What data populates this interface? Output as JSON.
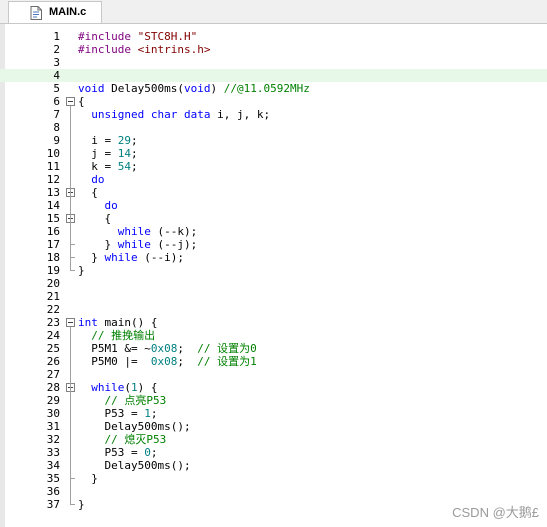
{
  "tab": {
    "label": "MAIN.c",
    "icon": "c-file-icon"
  },
  "lines": [
    {
      "n": "1",
      "tokens": [
        {
          "t": "#include ",
          "c": "pp"
        },
        {
          "t": "\"STC8H.H\"",
          "c": "str"
        }
      ]
    },
    {
      "n": "2",
      "tokens": [
        {
          "t": "#include ",
          "c": "pp"
        },
        {
          "t": "<intrins.h>",
          "c": "str"
        }
      ]
    },
    {
      "n": "3",
      "tokens": []
    },
    {
      "n": "4",
      "tokens": [],
      "highlight": true
    },
    {
      "n": "5",
      "tokens": [
        {
          "t": "void",
          "c": "kw"
        },
        {
          "t": " Delay500ms(",
          "c": "id"
        },
        {
          "t": "void",
          "c": "kw"
        },
        {
          "t": ")\t",
          "c": "id"
        },
        {
          "t": "//@11.0592MHz",
          "c": "cm"
        }
      ]
    },
    {
      "n": "6",
      "tokens": [
        {
          "t": "{",
          "c": "id"
        }
      ]
    },
    {
      "n": "7",
      "tokens": [
        {
          "t": "  ",
          "c": "id"
        },
        {
          "t": "unsigned char data",
          "c": "kw"
        },
        {
          "t": " i, j, k;",
          "c": "id"
        }
      ]
    },
    {
      "n": "8",
      "tokens": []
    },
    {
      "n": "9",
      "tokens": [
        {
          "t": "  i = ",
          "c": "id"
        },
        {
          "t": "29",
          "c": "num"
        },
        {
          "t": ";",
          "c": "id"
        }
      ]
    },
    {
      "n": "10",
      "tokens": [
        {
          "t": "  j = ",
          "c": "id"
        },
        {
          "t": "14",
          "c": "num"
        },
        {
          "t": ";",
          "c": "id"
        }
      ]
    },
    {
      "n": "11",
      "tokens": [
        {
          "t": "  k = ",
          "c": "id"
        },
        {
          "t": "54",
          "c": "num"
        },
        {
          "t": ";",
          "c": "id"
        }
      ]
    },
    {
      "n": "12",
      "tokens": [
        {
          "t": "  ",
          "c": "id"
        },
        {
          "t": "do",
          "c": "kw"
        }
      ]
    },
    {
      "n": "13",
      "tokens": [
        {
          "t": "  {",
          "c": "id"
        }
      ]
    },
    {
      "n": "14",
      "tokens": [
        {
          "t": "    ",
          "c": "id"
        },
        {
          "t": "do",
          "c": "kw"
        }
      ]
    },
    {
      "n": "15",
      "tokens": [
        {
          "t": "    {",
          "c": "id"
        }
      ]
    },
    {
      "n": "16",
      "tokens": [
        {
          "t": "      ",
          "c": "id"
        },
        {
          "t": "while",
          "c": "kw"
        },
        {
          "t": " (--k);",
          "c": "id"
        }
      ]
    },
    {
      "n": "17",
      "tokens": [
        {
          "t": "    } ",
          "c": "id"
        },
        {
          "t": "while",
          "c": "kw"
        },
        {
          "t": " (--j);",
          "c": "id"
        }
      ]
    },
    {
      "n": "18",
      "tokens": [
        {
          "t": "  } ",
          "c": "id"
        },
        {
          "t": "while",
          "c": "kw"
        },
        {
          "t": " (--i);",
          "c": "id"
        }
      ]
    },
    {
      "n": "19",
      "tokens": [
        {
          "t": "}",
          "c": "id"
        }
      ]
    },
    {
      "n": "20",
      "tokens": []
    },
    {
      "n": "21",
      "tokens": []
    },
    {
      "n": "22",
      "tokens": []
    },
    {
      "n": "23",
      "tokens": [
        {
          "t": "int",
          "c": "kw"
        },
        {
          "t": " main() {",
          "c": "id"
        }
      ]
    },
    {
      "n": "24",
      "tokens": [
        {
          "t": "  ",
          "c": "id"
        },
        {
          "t": "// 推挽输出",
          "c": "cm"
        }
      ]
    },
    {
      "n": "25",
      "tokens": [
        {
          "t": "  P5M1 &= ~",
          "c": "id"
        },
        {
          "t": "0x08",
          "c": "num"
        },
        {
          "t": ";  ",
          "c": "id"
        },
        {
          "t": "// 设置为0",
          "c": "cm"
        }
      ]
    },
    {
      "n": "26",
      "tokens": [
        {
          "t": "  P5M0 |=  ",
          "c": "id"
        },
        {
          "t": "0x08",
          "c": "num"
        },
        {
          "t": ";  ",
          "c": "id"
        },
        {
          "t": "// 设置为1",
          "c": "cm"
        }
      ]
    },
    {
      "n": "27",
      "tokens": []
    },
    {
      "n": "28",
      "tokens": [
        {
          "t": "  ",
          "c": "id"
        },
        {
          "t": "while",
          "c": "kw"
        },
        {
          "t": "(",
          "c": "id"
        },
        {
          "t": "1",
          "c": "num"
        },
        {
          "t": ") {",
          "c": "id"
        }
      ]
    },
    {
      "n": "29",
      "tokens": [
        {
          "t": "    ",
          "c": "id"
        },
        {
          "t": "// 点亮P53",
          "c": "cm"
        }
      ]
    },
    {
      "n": "30",
      "tokens": [
        {
          "t": "    P53 = ",
          "c": "id"
        },
        {
          "t": "1",
          "c": "num"
        },
        {
          "t": ";",
          "c": "id"
        }
      ]
    },
    {
      "n": "31",
      "tokens": [
        {
          "t": "    Delay500ms();",
          "c": "id"
        }
      ]
    },
    {
      "n": "32",
      "tokens": [
        {
          "t": "    ",
          "c": "id"
        },
        {
          "t": "// 熄灭P53",
          "c": "cm"
        }
      ]
    },
    {
      "n": "33",
      "tokens": [
        {
          "t": "    P53 = ",
          "c": "id"
        },
        {
          "t": "0",
          "c": "num"
        },
        {
          "t": ";",
          "c": "id"
        }
      ]
    },
    {
      "n": "34",
      "tokens": [
        {
          "t": "    Delay500ms();",
          "c": "id"
        }
      ]
    },
    {
      "n": "35",
      "tokens": [
        {
          "t": "  }",
          "c": "id"
        }
      ]
    },
    {
      "n": "36",
      "tokens": []
    },
    {
      "n": "37",
      "tokens": [
        {
          "t": "}",
          "c": "id"
        }
      ]
    }
  ],
  "watermark": "CSDN @大鹅£",
  "colors": {
    "keyword": "#0000ff",
    "preprocessor": "#7f007f",
    "string": "#800000",
    "number": "#008080",
    "comment": "#008000",
    "highlight_line": "#e8f8e8"
  }
}
